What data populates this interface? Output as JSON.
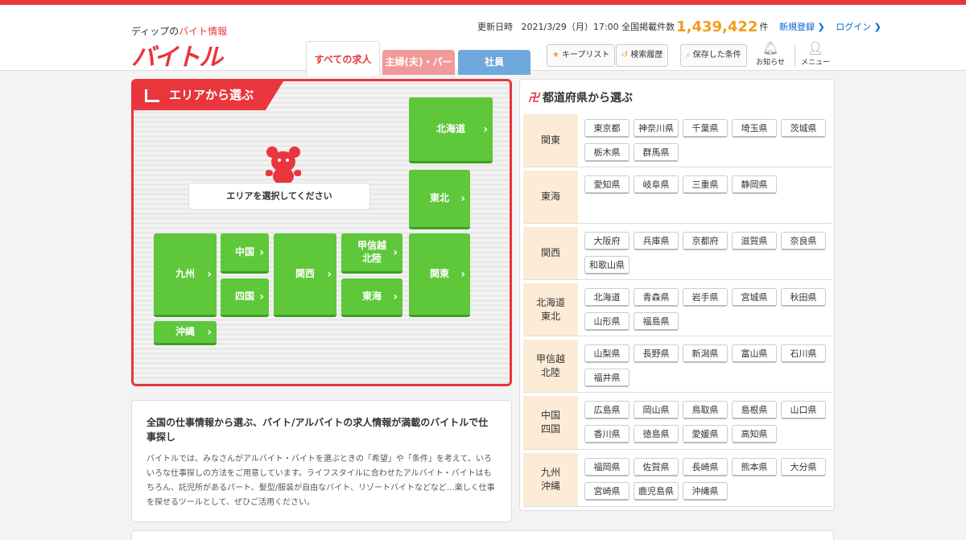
{
  "header": {
    "logo_sub_prefix": "ディップの",
    "logo_sub_red": "バイト情報",
    "logo_main": "バイトル",
    "update_label": "更新日時",
    "update_date": "2021/3/29（月）17:00",
    "total_label": "全国掲載件数",
    "total_count": "1,439,422",
    "count_unit": "件",
    "register": "新規登録 ❯",
    "login": "ログイン ❯",
    "tabs": [
      "すべての求人",
      "主婦(夫)・パート",
      "社員"
    ],
    "keeplist": "キープリスト",
    "history": "検索履歴",
    "saved": "保存した条件",
    "notify": "お知らせ",
    "menu": "メニュー"
  },
  "area": {
    "title": "エリアから選ぶ",
    "prompt": "エリアを選択してください",
    "regions": {
      "hokkaido": "北海道",
      "tohoku": "東北",
      "kanto": "関東",
      "koshinetsu": "甲信越\n北陸",
      "tokai": "東海",
      "kansai": "関西",
      "chugoku": "中国",
      "shikoku": "四国",
      "kyushu": "九州",
      "okinawa": "沖縄"
    }
  },
  "description": {
    "heading": "全国の仕事情報から選ぶ、バイト/アルバイトの求人情報が満載のバイトルで仕事探し",
    "body": "バイトルでは、みなさんがアルバイト・バイトを選ぶときの「希望」や「条件」を考えて、いろいろな仕事探しの方法をご用意しています。ライフスタイルに合わせたアルバイト・バイトはもちろん、託児所があるパート、髪型/服装が自由なバイト、リゾートバイトなどなど…楽しく仕事を探せるツールとして、ぜひご活用ください。"
  },
  "prefectures": {
    "title": "都道府県から選ぶ",
    "rows": [
      {
        "label": "関東",
        "prefs": [
          "東京都",
          "神奈川県",
          "千葉県",
          "埼玉県",
          "茨城県",
          "栃木県",
          "群馬県"
        ]
      },
      {
        "label": "東海",
        "prefs": [
          "愛知県",
          "岐阜県",
          "三重県",
          "静岡県"
        ]
      },
      {
        "label": "関西",
        "prefs": [
          "大阪府",
          "兵庫県",
          "京都府",
          "滋賀県",
          "奈良県",
          "和歌山県"
        ]
      },
      {
        "label": "北海道\n東北",
        "prefs": [
          "北海道",
          "青森県",
          "岩手県",
          "宮城県",
          "秋田県",
          "山形県",
          "福島県"
        ]
      },
      {
        "label": "甲信越\n北陸",
        "prefs": [
          "山梨県",
          "長野県",
          "新潟県",
          "富山県",
          "石川県",
          "福井県"
        ]
      },
      {
        "label": "中国\n四国",
        "prefs": [
          "広島県",
          "岡山県",
          "鳥取県",
          "島根県",
          "山口県",
          "香川県",
          "徳島県",
          "愛媛県",
          "高知県"
        ]
      },
      {
        "label": "九州\n沖縄",
        "prefs": [
          "福岡県",
          "佐賀県",
          "長崎県",
          "熊本県",
          "大分県",
          "宮崎県",
          "鹿児島県",
          "沖縄県"
        ]
      }
    ]
  },
  "colors": {
    "brand_red": "#e8363c",
    "region_green": "#5ec83a",
    "count_orange": "#f29d1a",
    "label_bg": "#fcebd6"
  }
}
